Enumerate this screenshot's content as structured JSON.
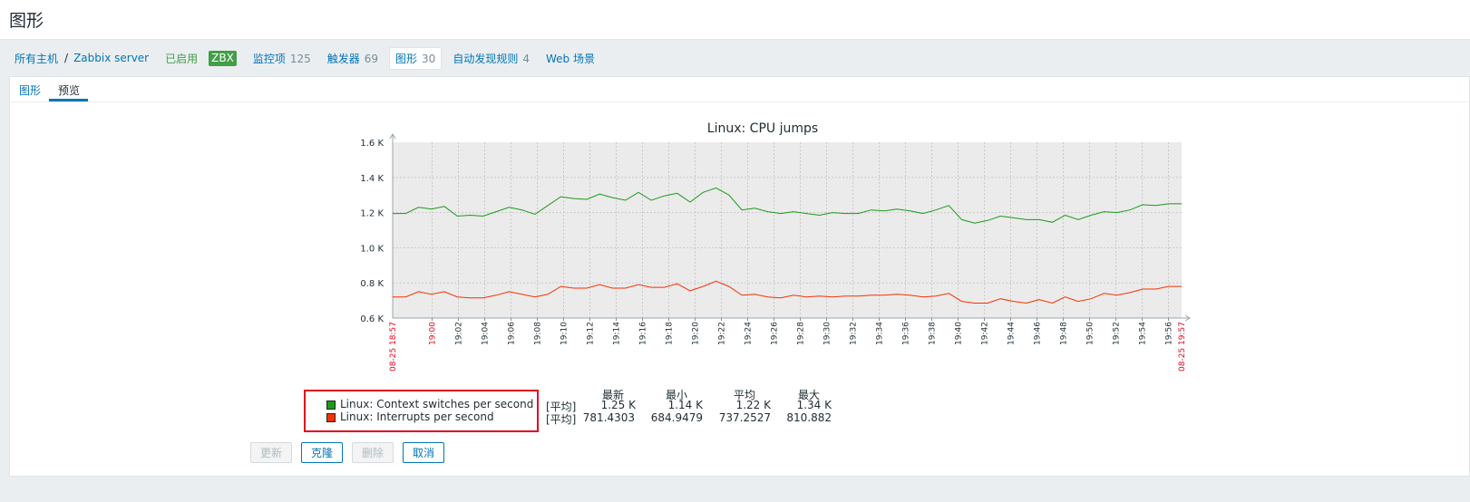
{
  "page": {
    "title": "图形"
  },
  "nav": {
    "all_hosts": "所有主机",
    "separator": "/",
    "host": "Zabbix server",
    "status": "已启用",
    "agent": "ZBX",
    "items": [
      {
        "label": "监控项",
        "count": "125"
      },
      {
        "label": "触发器",
        "count": "69"
      },
      {
        "label": "图形",
        "count": "30"
      },
      {
        "label": "自动发现规则",
        "count": "4"
      },
      {
        "label": "Web 场景",
        "count": ""
      }
    ]
  },
  "tabs": [
    {
      "label": "图形"
    },
    {
      "label": "预览"
    }
  ],
  "chart_data": {
    "type": "line",
    "title": "Linux: CPU jumps",
    "y_ticks": [
      "1.6 K",
      "1.4 K",
      "1.2 K",
      "1.0 K",
      "0.8 K",
      "0.6 K"
    ],
    "ylim": [
      600,
      1600
    ],
    "grid": true,
    "x_start_label": "08-25 18:57",
    "x_end_label": "08-25 19:57",
    "x_tick_labels": [
      "19:00",
      "19:02",
      "19:04",
      "19:06",
      "19:08",
      "19:10",
      "19:12",
      "19:14",
      "19:16",
      "19:18",
      "19:20",
      "19:22",
      "19:24",
      "19:26",
      "19:28",
      "19:30",
      "19:32",
      "19:34",
      "19:36",
      "19:38",
      "19:40",
      "19:42",
      "19:44",
      "19:46",
      "19:48",
      "19:50",
      "19:52",
      "19:54",
      "19:56"
    ],
    "series": [
      {
        "name": "Linux: Context switches per second",
        "color": "#1a9a1a",
        "values": [
          1195,
          1195,
          1230,
          1220,
          1235,
          1180,
          1185,
          1180,
          1205,
          1230,
          1215,
          1190,
          1240,
          1290,
          1280,
          1275,
          1305,
          1285,
          1270,
          1315,
          1270,
          1295,
          1310,
          1260,
          1315,
          1340,
          1300,
          1215,
          1225,
          1205,
          1195,
          1205,
          1195,
          1185,
          1200,
          1195,
          1195,
          1215,
          1210,
          1220,
          1210,
          1195,
          1215,
          1240,
          1160,
          1140,
          1155,
          1180,
          1170,
          1160,
          1160,
          1145,
          1185,
          1160,
          1185,
          1205,
          1200,
          1215,
          1245,
          1240,
          1250,
          1250
        ]
      },
      {
        "name": "Linux: Interrupts per second",
        "color": "#f63100",
        "values": [
          720,
          720,
          750,
          735,
          750,
          720,
          715,
          715,
          730,
          750,
          735,
          720,
          735,
          780,
          770,
          770,
          790,
          770,
          770,
          790,
          775,
          775,
          795,
          755,
          780,
          810,
          780,
          730,
          735,
          720,
          715,
          730,
          720,
          725,
          720,
          725,
          725,
          730,
          730,
          735,
          730,
          720,
          725,
          740,
          695,
          685,
          685,
          710,
          695,
          685,
          705,
          685,
          720,
          695,
          710,
          740,
          730,
          745,
          765,
          765,
          780,
          780
        ]
      }
    ],
    "legend_items": [
      {
        "name": "Linux: Context switches per second",
        "func": "[平均]",
        "last": "1.25 K",
        "min": "1.14 K",
        "avg": "1.22 K",
        "max": "1.34 K"
      },
      {
        "name": "Linux: Interrupts per second",
        "func": "[平均]",
        "last": "781.4303",
        "min": "684.9479",
        "avg": "737.2527",
        "max": "810.882"
      }
    ],
    "stat_headers": [
      "最新",
      "最小",
      "平均",
      "最大"
    ]
  },
  "buttons": {
    "update": "更新",
    "clone": "克隆",
    "delete": "删除",
    "cancel": "取消"
  },
  "colors": {
    "link": "#0275b8",
    "enabled": "#429e47",
    "highlight": "#e0071e"
  }
}
